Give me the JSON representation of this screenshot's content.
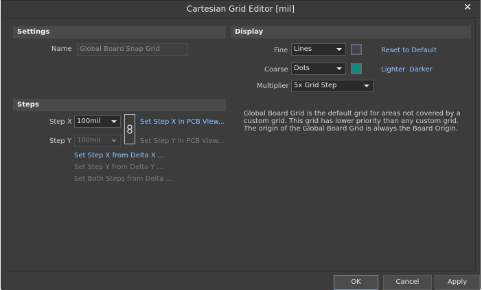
{
  "window": {
    "title": "Cartesian Grid Editor [mil]"
  },
  "settings": {
    "header": "Settings",
    "name_label": "Name",
    "name_value": "Global Board Snap Grid"
  },
  "steps": {
    "header": "Steps",
    "step_x_label": "Step X",
    "step_x_value": "100mil",
    "step_y_label": "Step Y",
    "step_y_value": "100mil",
    "set_step_x_pcb": "Set Step X in PCB View...",
    "set_step_y_pcb": "Set Step Y in PCB View...",
    "set_step_x_delta": "Set Step X from Delta X ...",
    "set_step_y_delta": "Set Step Y from Delta Y ...",
    "set_both_delta": "Set Both Steps from Delta ..."
  },
  "display": {
    "header": "Display",
    "fine_label": "Fine",
    "fine_value": "Lines",
    "fine_color": "#3f3f55",
    "coarse_label": "Coarse",
    "coarse_value": "Dots",
    "coarse_color": "#0c8c86",
    "multiplier_label": "Multiplier",
    "multiplier_value": "5x Grid Step",
    "reset_link": "Reset to Default",
    "lighter_link": "Lighter",
    "darker_link": "Darker",
    "description": "Global Board Grid is the default grid for areas not covered by a custom grid. This grid has lower priority than any custom grid. The origin of the Global Board Grid is always the Board Origin."
  },
  "buttons": {
    "ok": "OK",
    "cancel": "Cancel",
    "apply": "Apply"
  },
  "icons": {
    "close": "close-icon",
    "link": "link-icon",
    "dropdown": "chevron-down-icon"
  }
}
